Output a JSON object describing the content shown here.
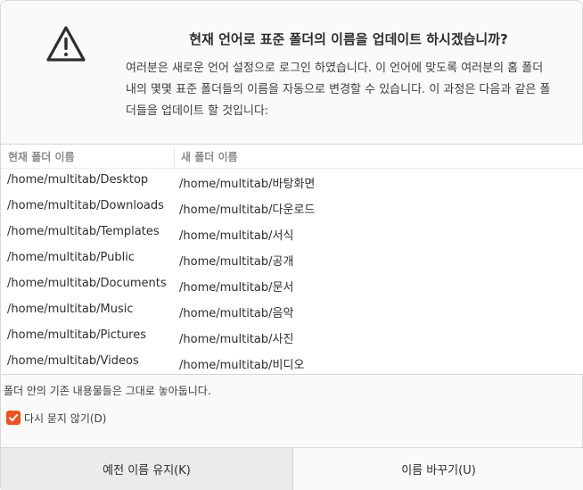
{
  "dialog": {
    "icon": "warning-triangle-icon",
    "title": "현재 언어로 표준 폴더의 이름을 업데이트 하시겠습니까?",
    "description": "여러분은 새로운 언어 설정으로 로그인 하였습니다. 이 언어에 맞도록 여러분의 홈 폴더 내의 몇몇 표준 폴더들의 이름을 자동으로 변경할 수 있습니다. 이 과정은 다음과 같은 폴더들을 업데이트 할 것입니다:"
  },
  "table": {
    "columns": [
      "현재 폴더 이름",
      "새 폴더 이름"
    ],
    "rows": [
      [
        "/home/multitab/Desktop",
        "/home/multitab/바탕화면"
      ],
      [
        "/home/multitab/Downloads",
        "/home/multitab/다운로드"
      ],
      [
        "/home/multitab/Templates",
        "/home/multitab/서식"
      ],
      [
        "/home/multitab/Public",
        "/home/multitab/공개"
      ],
      [
        "/home/multitab/Documents",
        "/home/multitab/문서"
      ],
      [
        "/home/multitab/Music",
        "/home/multitab/음악"
      ],
      [
        "/home/multitab/Pictures",
        "/home/multitab/사진"
      ],
      [
        "/home/multitab/Videos",
        "/home/multitab/비디오"
      ]
    ]
  },
  "note": "폴더 안의 기존 내용물들은 그대로 놓아둡니다.",
  "dont_ask": {
    "label": "다시 묻지 않기(D)",
    "checked": true
  },
  "buttons": {
    "keep": "예전 이름 유지(K)",
    "rename": "이름 바꾸기(U)"
  },
  "colors": {
    "accent": "#e95420",
    "background": "#fafafa"
  }
}
